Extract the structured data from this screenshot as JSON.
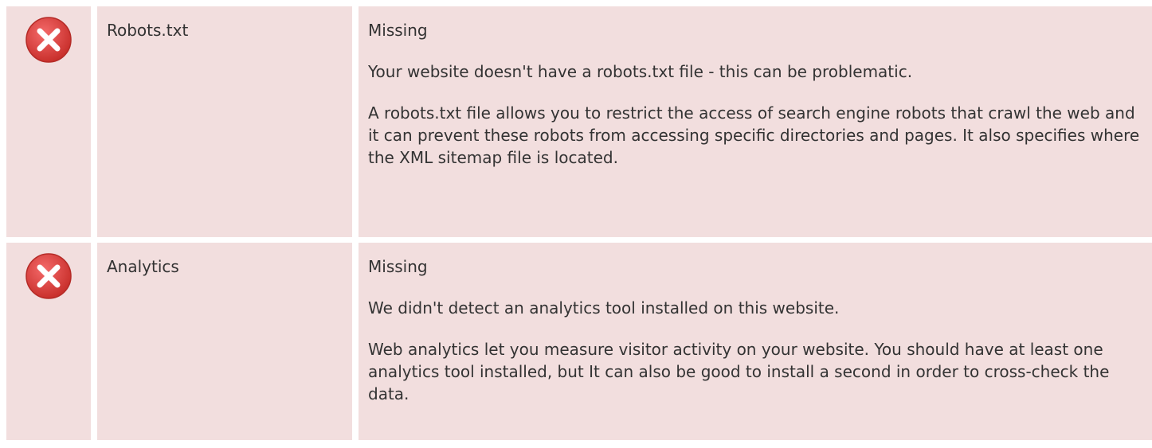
{
  "rows": [
    {
      "icon": "error-x-icon",
      "name": "Robots.txt",
      "status": "Missing",
      "message": "Your website doesn't have a robots.txt file - this can be problematic.",
      "description": "A robots.txt file allows you to restrict the access of search engine robots that crawl the web and it can prevent these robots from accessing specific directories and pages. It also specifies where the XML sitemap file is located."
    },
    {
      "icon": "error-x-icon",
      "name": "Analytics",
      "status": "Missing",
      "message": "We didn't detect an analytics tool installed on this website.",
      "description": "Web analytics let you measure visitor activity on your website. You should have at least one analytics tool installed, but It can also be good to install a second in order to cross-check the data."
    }
  ],
  "colors": {
    "row_bg": "#f2dede",
    "icon_red": "#d9534f",
    "text": "#333333"
  }
}
